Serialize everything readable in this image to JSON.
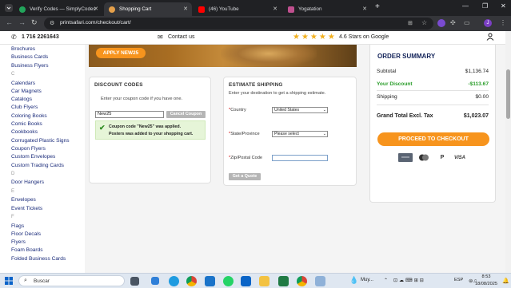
{
  "browser": {
    "tabs": [
      {
        "label": "Verify Codes — SimplyCodes",
        "fav_color": "#22a55b",
        "active": false
      },
      {
        "label": "Shopping Cart",
        "fav_color": "#e5a04a",
        "active": true
      },
      {
        "label": "(46) YouTube",
        "fav_color": "#ff0000",
        "active": false
      },
      {
        "label": "Yogatation",
        "fav_color": "#c0508f",
        "active": false
      }
    ],
    "new_tab_symbol": "+",
    "url": "printsafari.com/checkout/cart/",
    "profile_initial": "J"
  },
  "topbar": {
    "phone": "1 716 2261643",
    "contact": "Contact us",
    "stars_text": "4.6 Stars on Google",
    "star_glyphs": "★★★★★"
  },
  "sidebar": {
    "items": [
      {
        "type": "item",
        "label": "Brochures"
      },
      {
        "type": "item",
        "label": "Business Cards"
      },
      {
        "type": "item",
        "label": "Business Flyers"
      },
      {
        "type": "letter",
        "label": "C"
      },
      {
        "type": "item",
        "label": "Calendars"
      },
      {
        "type": "item",
        "label": "Car Magnets"
      },
      {
        "type": "item",
        "label": "Catalogs"
      },
      {
        "type": "item",
        "label": "Club Flyers"
      },
      {
        "type": "item",
        "label": "Coloring Books"
      },
      {
        "type": "item",
        "label": "Comic Books"
      },
      {
        "type": "item",
        "label": "Cookbooks"
      },
      {
        "type": "item",
        "label": "Corrugated Plastic Signs"
      },
      {
        "type": "item",
        "label": "Coupon Flyers"
      },
      {
        "type": "item",
        "label": "Custom Envelopes"
      },
      {
        "type": "item",
        "label": "Custom Trading Cards"
      },
      {
        "type": "letter",
        "label": "D"
      },
      {
        "type": "item",
        "label": "Door Hangers"
      },
      {
        "type": "letter",
        "label": "E"
      },
      {
        "type": "item",
        "label": "Envelopes"
      },
      {
        "type": "item",
        "label": "Event Tickets"
      },
      {
        "type": "letter",
        "label": "F"
      },
      {
        "type": "item",
        "label": "Flags"
      },
      {
        "type": "item",
        "label": "Floor Decals"
      },
      {
        "type": "item",
        "label": "Flyers"
      },
      {
        "type": "item",
        "label": "Foam Boards"
      },
      {
        "type": "item",
        "label": "Folded Business Cards"
      }
    ]
  },
  "banner": {
    "button_label": "APPLY NEW25"
  },
  "discount": {
    "title": "DISCOUNT CODES",
    "instruction": "Enter your coupon code if you have one.",
    "code_value": "New25",
    "cancel_label": "Cancel Coupon",
    "success_line1": "Coupon code \"New25\" was applied.",
    "success_line2": "Posters was added to your shopping cart."
  },
  "shipping": {
    "title": "ESTIMATE SHIPPING",
    "instruction": "Enter your destination to get a shipping estimate.",
    "country_label": "Country",
    "country_value": "United States",
    "state_label": "State/Province",
    "state_value": "Please select",
    "zip_label": "Zip/Postal Code",
    "zip_value": "",
    "quote_label": "Get a Quote",
    "required_mark": "*"
  },
  "summary": {
    "title": "ORDER SUMMARY",
    "subtotal_label": "Subtotal",
    "subtotal_value": "$1,136.74",
    "discount_label": "Your Discount",
    "discount_value": "-$113.67",
    "shipping_label": "Shipping",
    "shipping_value": "$0.00",
    "grand_label": "Grand Total Excl. Tax",
    "grand_value": "$1,023.07",
    "checkout_label": "PROCEED TO CHECKOUT",
    "payment_labels": [
      "",
      "",
      "P",
      "VISA"
    ],
    "accent_color": "#f7941d",
    "discount_color": "#2a9d2a"
  },
  "taskbar": {
    "search_placeholder": "Buscar",
    "weather": "Muy...",
    "language": "ESP",
    "time": "8:53",
    "date": "18/08/2025"
  }
}
